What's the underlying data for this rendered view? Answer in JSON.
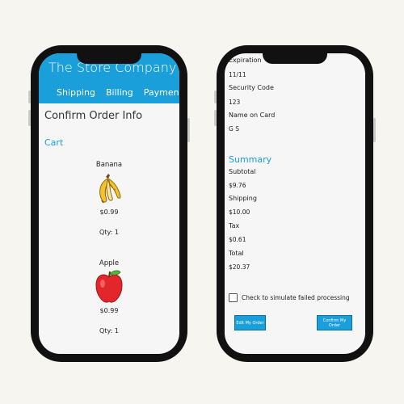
{
  "left": {
    "header": {
      "store_name": "The Store Company",
      "tabs": [
        "Shipping",
        "Billing",
        "Payment"
      ]
    },
    "page_title": "Confirm Order Info",
    "cart_label": "Cart",
    "items": [
      {
        "name": "Banana",
        "icon": "banana-icon",
        "price": "$0.99",
        "qty": "Qty: 1"
      },
      {
        "name": "Apple",
        "icon": "apple-icon",
        "price": "$0.99",
        "qty": "Qty: 1"
      }
    ]
  },
  "right": {
    "payment": {
      "expiration_label": "Expiration",
      "expiration_value": "11/11",
      "security_label": "Security Code",
      "security_value": "123",
      "name_label": "Name on Card",
      "name_value": "G S"
    },
    "summary": {
      "title": "Summary",
      "subtotal_label": "Subtotal",
      "subtotal_value": "$9.76",
      "shipping_label": "Shipping",
      "shipping_value": "$10.00",
      "tax_label": "Tax",
      "tax_value": "$0.61",
      "total_label": "Total",
      "total_value": "$20.37"
    },
    "simulate_label": "Check to simulate failed processing",
    "simulate_checked": false,
    "edit_button": "Edit My Order",
    "confirm_button": "Confirm My Order"
  },
  "colors": {
    "accent": "#1a9fdb",
    "phone_frame": "#111111",
    "background": "#f7f5f0"
  }
}
